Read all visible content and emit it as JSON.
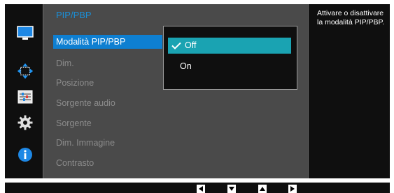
{
  "menu": {
    "title": "PIP/PBP",
    "items": [
      {
        "label": "Modalità PIP/PBP",
        "active": true
      },
      {
        "label": "Dim."
      },
      {
        "label": "Posizione"
      },
      {
        "label": "Sorgente audio"
      },
      {
        "label": "Sorgente"
      },
      {
        "label": "Dim. Immagine"
      },
      {
        "label": "Contrasto"
      }
    ]
  },
  "dropdown": {
    "options": [
      {
        "label": "Off",
        "selected": true
      },
      {
        "label": "On"
      }
    ]
  },
  "help": {
    "text": "Attivare o disattivare la modalità PIP/PBP."
  },
  "sidebar": {
    "icons": [
      "monitor-icon",
      "position-arrows-icon",
      "settings-sliders-icon",
      "gear-icon",
      "info-icon"
    ]
  },
  "nav": {
    "buttons": [
      "left-arrow-icon",
      "down-arrow-icon",
      "up-arrow-icon",
      "right-arrow-icon"
    ]
  },
  "colors": {
    "accent_blue": "#0e7fd1",
    "title_blue": "#1a8fd8",
    "selected_teal": "#1aa3b2",
    "panel_gray": "#4a4a4a",
    "background": "#0f0f0f"
  }
}
